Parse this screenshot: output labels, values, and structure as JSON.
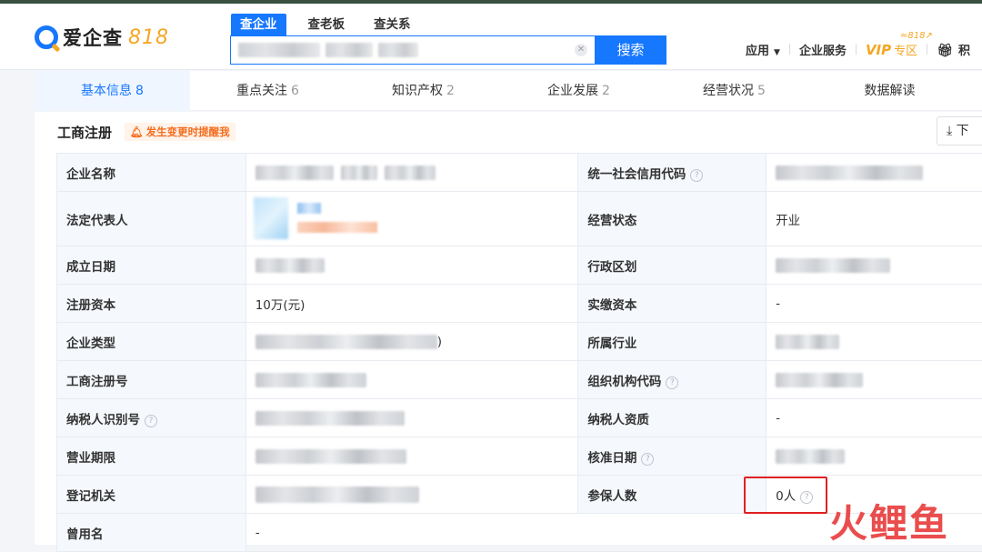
{
  "brand": {
    "name": "爱企查",
    "badge": "818",
    "accent": "#1677ff",
    "badge_color": "#f5a623"
  },
  "search": {
    "tabs": [
      {
        "label": "查企业",
        "active": true
      },
      {
        "label": "查老板",
        "active": false
      },
      {
        "label": "查关系",
        "active": false
      }
    ],
    "clear_icon": "close-icon",
    "button_label": "搜索"
  },
  "nav": {
    "apps_label": "应用",
    "enterprise_label": "企业服务",
    "vip_label": "VIP",
    "vip_zone_label": "专区",
    "vip_818": "≈818↗",
    "points_label": "积"
  },
  "tabs": [
    {
      "label": "基本信息",
      "count": "8",
      "active": true
    },
    {
      "label": "重点关注",
      "count": "6",
      "active": false
    },
    {
      "label": "知识产权",
      "count": "2",
      "active": false
    },
    {
      "label": "企业发展",
      "count": "2",
      "active": false
    },
    {
      "label": "经营状况",
      "count": "5",
      "active": false
    },
    {
      "label": "数据解读",
      "count": "",
      "active": false
    }
  ],
  "section": {
    "title": "工商注册",
    "remind_label": "发生变更时提醒我",
    "download_label": "下"
  },
  "info": {
    "company_name_label": "企业名称",
    "credit_code_label": "统一社会信用代码",
    "legal_rep_label": "法定代表人",
    "status_label": "经营状态",
    "status_value": "开业",
    "established_label": "成立日期",
    "region_label": "行政区划",
    "capital_label": "注册资本",
    "capital_value": "10万(元)",
    "paid_capital_label": "实缴资本",
    "paid_capital_value": "-",
    "company_type_label": "企业类型",
    "company_type_suffix": ")",
    "industry_label": "所属行业",
    "reg_number_label": "工商注册号",
    "org_code_label": "组织机构代码",
    "taxpayer_id_label": "纳税人识别号",
    "taxpayer_qual_label": "纳税人资质",
    "taxpayer_qual_value": "-",
    "term_label": "营业期限",
    "approval_date_label": "核准日期",
    "authority_label": "登记机关",
    "insured_label": "参保人数",
    "insured_value": "0人",
    "former_name_label": "曾用名",
    "former_name_value": "-"
  },
  "watermark": "火鲤鱼"
}
